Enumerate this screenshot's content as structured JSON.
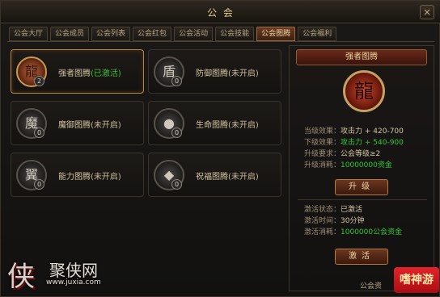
{
  "window": {
    "title": "公 会",
    "close_glyph": "×"
  },
  "tabs": [
    {
      "label": "公会大厅",
      "active": false
    },
    {
      "label": "公会成员",
      "active": false
    },
    {
      "label": "公会列表",
      "active": false
    },
    {
      "label": "公会红包",
      "active": false
    },
    {
      "label": "公会活动",
      "active": false
    },
    {
      "label": "公会技能",
      "active": false
    },
    {
      "label": "公会图腾",
      "active": true
    },
    {
      "label": "公会福利",
      "active": false
    }
  ],
  "totems": [
    {
      "name": "强者图腾",
      "state": "(已激活)",
      "level": "2",
      "icon": "dragon-totem-icon",
      "glyph": "龍",
      "selected": true,
      "active": true
    },
    {
      "name": "防御图腾",
      "state": "(未开启)",
      "level": "0",
      "icon": "shield-totem-icon",
      "glyph": "盾",
      "selected": false,
      "active": false
    },
    {
      "name": "魔御图腾",
      "state": "(未开启)",
      "level": "0",
      "icon": "skull-totem-icon",
      "glyph": "魔",
      "selected": false,
      "active": false
    },
    {
      "name": "生命图腾",
      "state": "(未开启)",
      "level": "0",
      "icon": "orb-totem-icon",
      "glyph": "●",
      "selected": false,
      "active": false
    },
    {
      "name": "能力图腾",
      "state": "(未开启)",
      "level": "0",
      "icon": "wings-totem-icon",
      "glyph": "翼",
      "selected": false,
      "active": false
    },
    {
      "name": "祝福图腾",
      "state": "(未开启)",
      "level": "0",
      "icon": "cube-totem-icon",
      "glyph": "◆",
      "selected": false,
      "active": false
    }
  ],
  "detail": {
    "header": "强者图腾",
    "icon_glyph": "龍",
    "current_effect_label": "当级效果：",
    "current_effect_value": "攻击力 + 420-700",
    "next_effect_label": "下级效果：",
    "next_effect_value": "攻击力 + 540-900",
    "upgrade_req_label": "升级要求：",
    "upgrade_req_value": "公会等级≥2",
    "upgrade_cost_label": "升级消耗：",
    "upgrade_cost_value": "10000000资金",
    "upgrade_button": "升级",
    "activate_status_label": "激活状态：",
    "activate_status_value": "已激活",
    "activate_time_label": "激活时间：",
    "activate_time_value": "30分钟",
    "activate_cost_label": "激活消耗：",
    "activate_cost_value": "1000000公会资金",
    "activate_button": "激活"
  },
  "footer": {
    "text": "公会资"
  },
  "watermark": {
    "char": "侠",
    "brand": "聚侠网",
    "url": "www.juxia.com",
    "badge": "嗜神游"
  },
  "colors": {
    "accent": "#b38346",
    "active_green": "#3fbf3a",
    "gold_text": "#d8b35c"
  }
}
